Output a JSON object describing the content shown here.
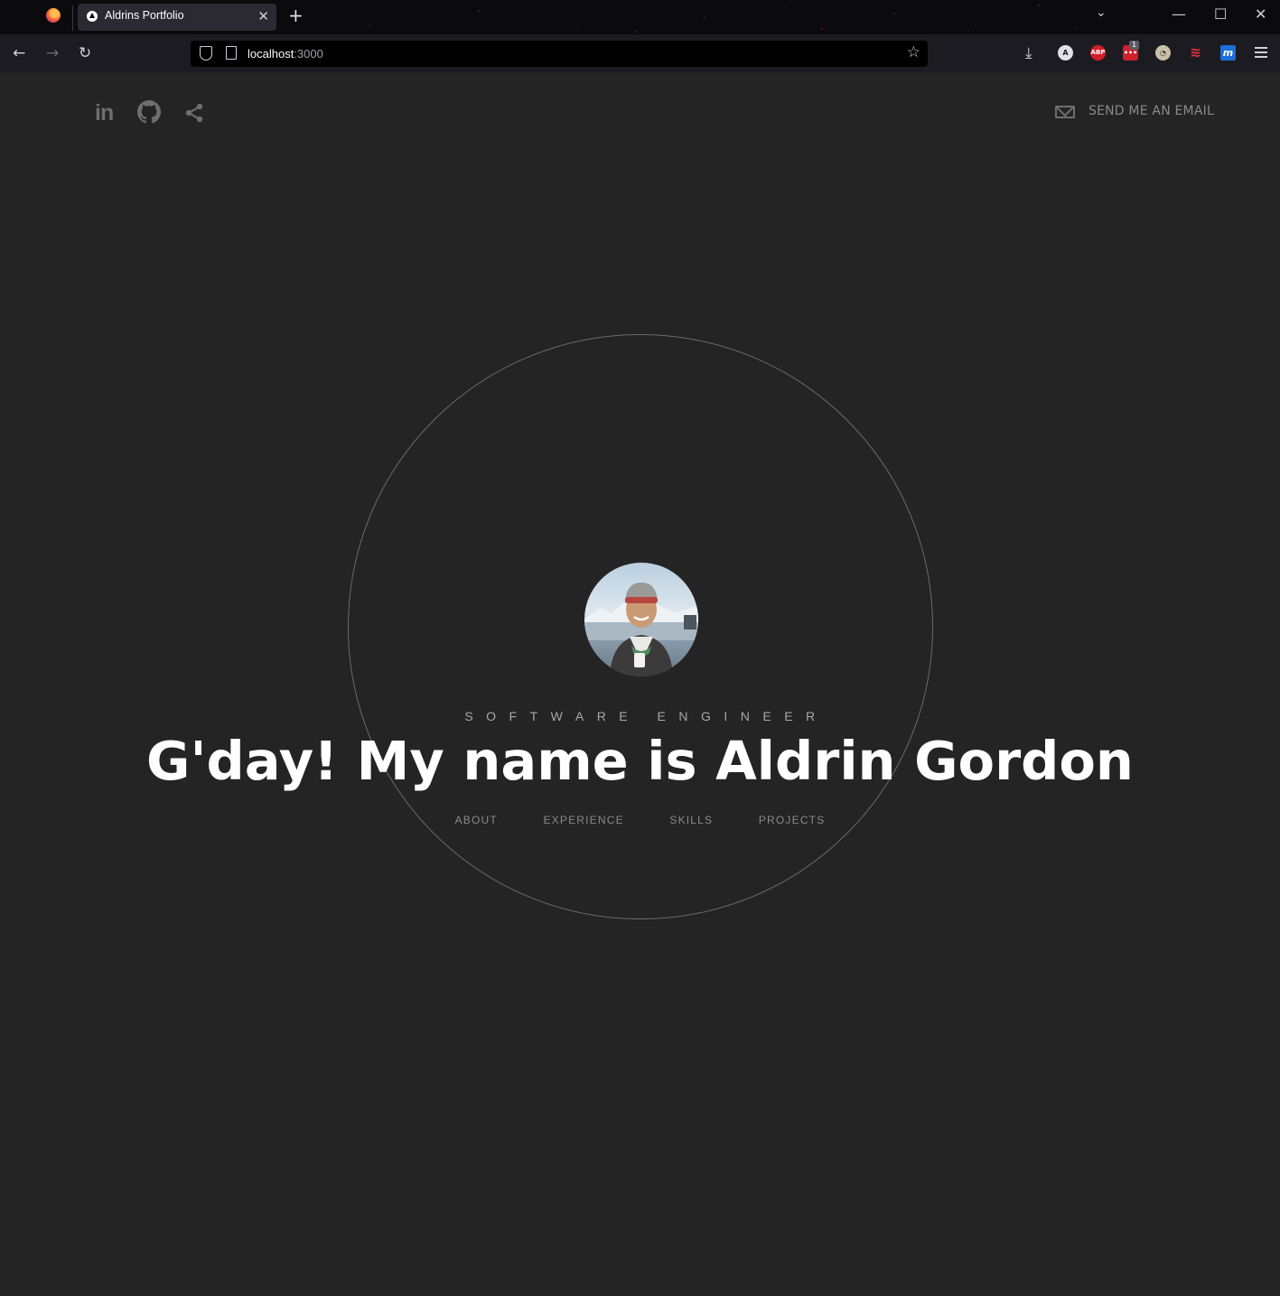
{
  "browser": {
    "tab_title": "Aldrins Portfolio",
    "url_host": "localhost",
    "url_port": ":3000",
    "extension_badge": "1"
  },
  "social": {
    "linkedin_label": "in",
    "email_label": "SEND ME AN EMAIL"
  },
  "hero": {
    "role": "SOFTWARE ENGINEER",
    "headline": "G'day! My name is Aldrin Gordon"
  },
  "nav": {
    "items": [
      "ABOUT",
      "EXPERIENCE",
      "SKILLS",
      "PROJECTS"
    ]
  },
  "colors": {
    "background": "#242424",
    "headline": "#ffffff",
    "muted": "#8a8a8a",
    "ring": "#6a6a6a"
  }
}
